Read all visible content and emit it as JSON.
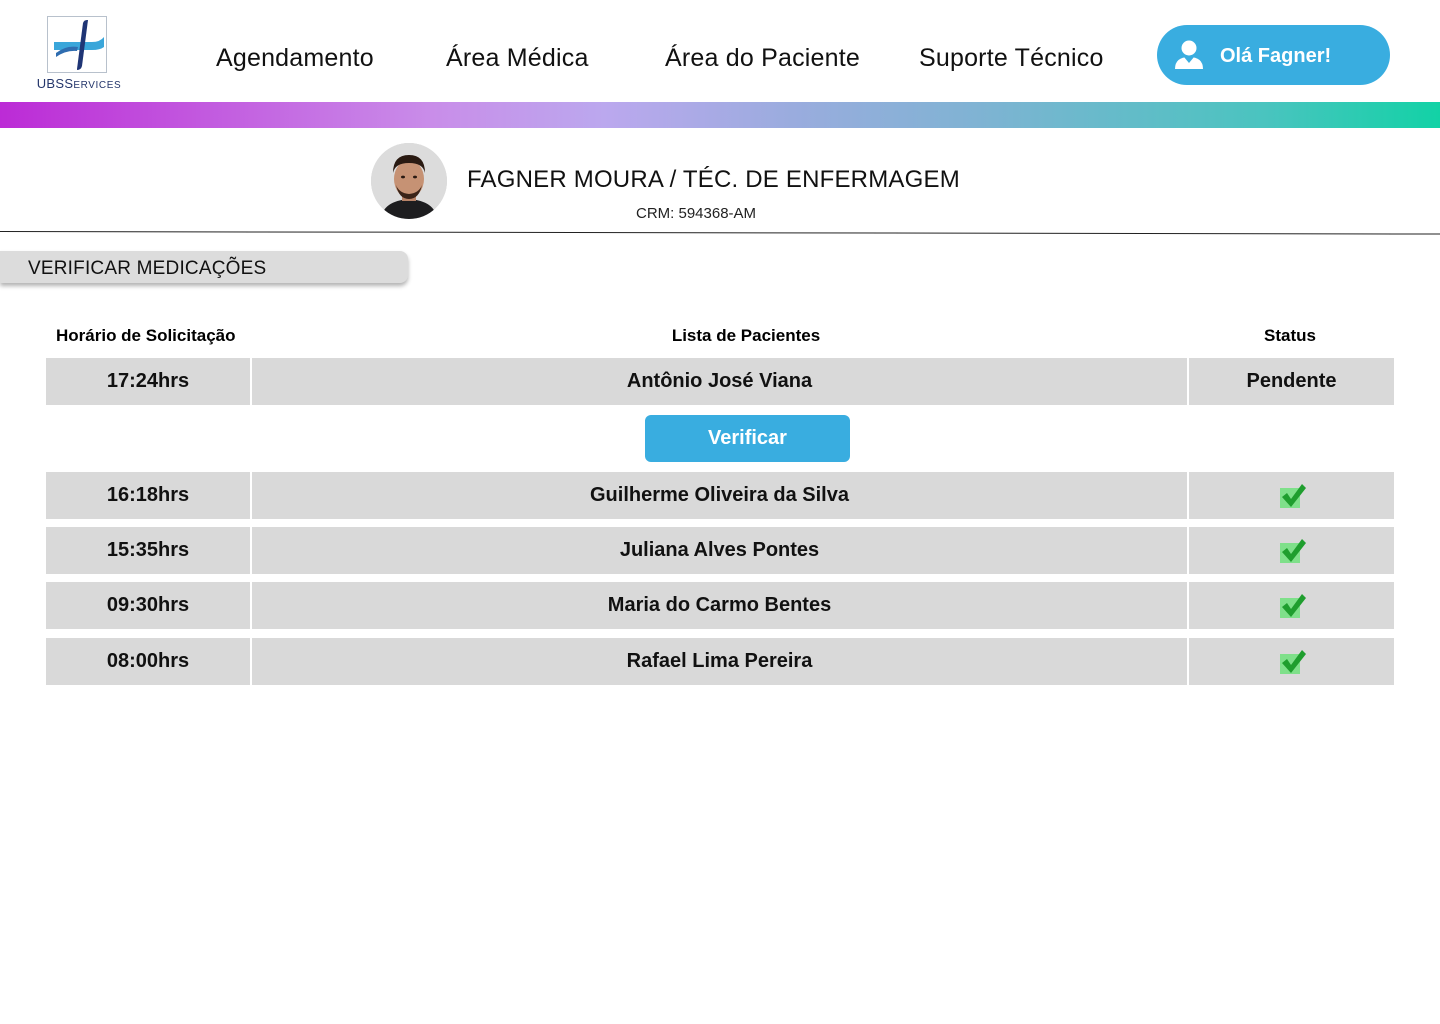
{
  "brand": {
    "logo_text_main": "UBS",
    "logo_text_small": "ERVICES",
    "logo_text_s": "S"
  },
  "nav": {
    "items": [
      "Agendamento",
      "Área Médica",
      "Área do Paciente",
      "Suporte Técnico"
    ],
    "user_button": "Olá Fagner!"
  },
  "profile": {
    "name": "FAGNER MOURA / TÉC. DE ENFERMAGEM",
    "crm": "CRM: 594368-AM"
  },
  "section": {
    "title": "VERIFICAR MEDICAÇÕES"
  },
  "table": {
    "headers": {
      "time": "Horário de Solicitação",
      "patients": "Lista de Pacientes",
      "status": "Status"
    },
    "rows": [
      {
        "time": "17:24hrs",
        "patient": "Antônio José Viana",
        "status": "Pendente"
      },
      {
        "time": "16:18hrs",
        "patient": "Guilherme Oliveira da Silva",
        "status": "check"
      },
      {
        "time": "15:35hrs",
        "patient": "Juliana Alves Pontes",
        "status": "check"
      },
      {
        "time": "09:30hrs",
        "patient": "Maria do Carmo Bentes",
        "status": "check"
      },
      {
        "time": "08:00hrs",
        "patient": "Rafael Lima Pereira",
        "status": "check"
      }
    ],
    "verify_button": "Verificar"
  },
  "colors": {
    "accent": "#39ade0",
    "row_bg": "#d9d9d9",
    "check": "#1f9e2e"
  }
}
